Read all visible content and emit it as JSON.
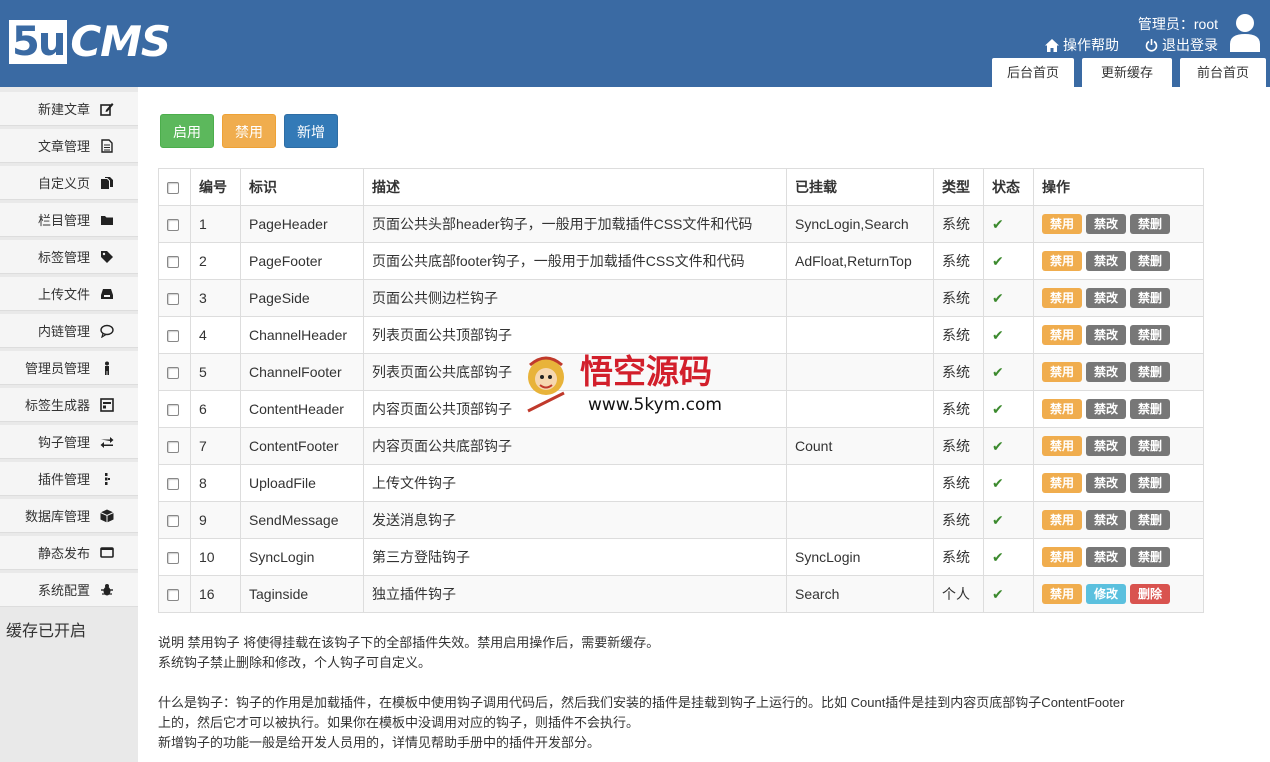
{
  "header": {
    "logo_box": "5u",
    "logo_rest": "CMS",
    "admin_label": "管理员：root",
    "help_label": "操作帮助",
    "logout_label": "退出登录",
    "tabs": [
      "后台首页",
      "更新缓存",
      "前台首页"
    ]
  },
  "sidebar": {
    "items": [
      {
        "label": "新建文章",
        "icon": "edit-icon"
      },
      {
        "label": "文章管理",
        "icon": "file-icon"
      },
      {
        "label": "自定义页",
        "icon": "files-icon"
      },
      {
        "label": "栏目管理",
        "icon": "folder-icon"
      },
      {
        "label": "标签管理",
        "icon": "tag-icon"
      },
      {
        "label": "上传文件",
        "icon": "inbox-icon"
      },
      {
        "label": "内链管理",
        "icon": "comment-icon"
      },
      {
        "label": "管理员管理",
        "icon": "user-icon"
      },
      {
        "label": "标签生成器",
        "icon": "window-icon"
      },
      {
        "label": "钩子管理",
        "icon": "exchange-icon"
      },
      {
        "label": "插件管理",
        "icon": "plugin-icon"
      },
      {
        "label": "数据库管理",
        "icon": "database-icon"
      },
      {
        "label": "静态发布",
        "icon": "monitor-icon"
      },
      {
        "label": "系统配置",
        "icon": "bug-icon"
      }
    ],
    "cache_status": "缓存已开启"
  },
  "toolbar": {
    "enable_label": "启用",
    "disable_label": "禁用",
    "add_label": "新增"
  },
  "table": {
    "headers": [
      "编号",
      "标识",
      "描述",
      "已挂载",
      "类型",
      "状态",
      "操作"
    ],
    "rows": [
      {
        "id": "1",
        "key": "PageHeader",
        "desc": "页面公共头部header钩子，一般用于加载插件CSS文件和代码",
        "mounted": "SyncLogin,Search",
        "type": "系统",
        "status": "✔",
        "actions": [
          "禁用",
          "禁改",
          "禁删"
        ]
      },
      {
        "id": "2",
        "key": "PageFooter",
        "desc": "页面公共底部footer钩子，一般用于加载插件CSS文件和代码",
        "mounted": "AdFloat,ReturnTop",
        "type": "系统",
        "status": "✔",
        "actions": [
          "禁用",
          "禁改",
          "禁删"
        ]
      },
      {
        "id": "3",
        "key": "PageSide",
        "desc": "页面公共侧边栏钩子",
        "mounted": "",
        "type": "系统",
        "status": "✔",
        "actions": [
          "禁用",
          "禁改",
          "禁删"
        ]
      },
      {
        "id": "4",
        "key": "ChannelHeader",
        "desc": "列表页面公共顶部钩子",
        "mounted": "",
        "type": "系统",
        "status": "✔",
        "actions": [
          "禁用",
          "禁改",
          "禁删"
        ]
      },
      {
        "id": "5",
        "key": "ChannelFooter",
        "desc": "列表页面公共底部钩子",
        "mounted": "",
        "type": "系统",
        "status": "✔",
        "actions": [
          "禁用",
          "禁改",
          "禁删"
        ]
      },
      {
        "id": "6",
        "key": "ContentHeader",
        "desc": "内容页面公共顶部钩子",
        "mounted": "",
        "type": "系统",
        "status": "✔",
        "actions": [
          "禁用",
          "禁改",
          "禁删"
        ]
      },
      {
        "id": "7",
        "key": "ContentFooter",
        "desc": "内容页面公共底部钩子",
        "mounted": "Count",
        "type": "系统",
        "status": "✔",
        "actions": [
          "禁用",
          "禁改",
          "禁删"
        ]
      },
      {
        "id": "8",
        "key": "UploadFile",
        "desc": "上传文件钩子",
        "mounted": "",
        "type": "系统",
        "status": "✔",
        "actions": [
          "禁用",
          "禁改",
          "禁删"
        ]
      },
      {
        "id": "9",
        "key": "SendMessage",
        "desc": "发送消息钩子",
        "mounted": "",
        "type": "系统",
        "status": "✔",
        "actions": [
          "禁用",
          "禁改",
          "禁删"
        ]
      },
      {
        "id": "10",
        "key": "SyncLogin",
        "desc": "第三方登陆钩子",
        "mounted": "SyncLogin",
        "type": "系统",
        "status": "✔",
        "actions": [
          "禁用",
          "禁改",
          "禁删"
        ]
      },
      {
        "id": "16",
        "key": "Taginside",
        "desc": "独立插件钩子",
        "mounted": "Search",
        "type": "个人",
        "status": "✔",
        "actions": [
          "禁用",
          "修改",
          "删除"
        ]
      }
    ]
  },
  "notes": {
    "line1": "说明 禁用钩子 将使得挂载在该钩子下的全部插件失效。禁用启用操作后，需要新缓存。",
    "line2": "系统钩子禁止删除和修改，个人钩子可自定义。",
    "line3": "什么是钩子：钩子的作用是加载插件，在模板中使用钩子调用代码后，然后我们安装的插件是挂载到钩子上运行的。比如 Count插件是挂到内容页底部钩子ContentFooter",
    "line4": "上的，然后它才可以被执行。如果你在模板中没调用对应的钩子，则插件不会执行。",
    "line5": "新增钩子的功能一般是给开发人员用的，详情见帮助手册中的插件开发部分。"
  },
  "watermark": {
    "title": "悟空源码",
    "url": "www.5kym.com"
  },
  "colors": {
    "header_bg": "#3a6aa3",
    "green": "#5cb85c",
    "orange": "#f0ad4e",
    "blue": "#337ab7",
    "gray": "#777777",
    "info": "#5bc0de",
    "red": "#d9534f"
  }
}
